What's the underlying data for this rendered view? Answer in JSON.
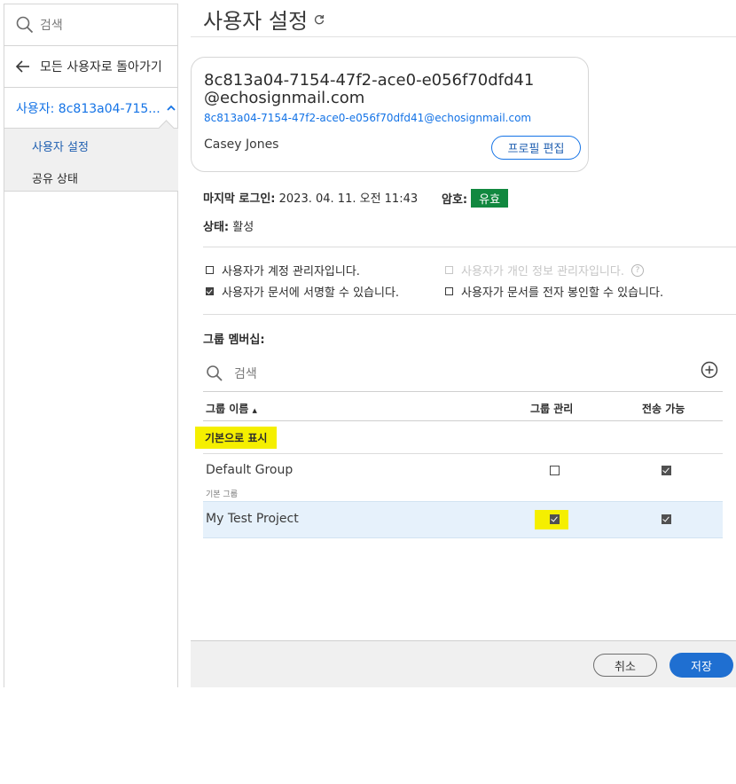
{
  "sidebar": {
    "search_placeholder": "검색",
    "back_label": "모든 사용자로 돌아가기",
    "user_label": "사용자: 8c813a04-715...",
    "items": [
      {
        "label": "사용자 설정",
        "active": true
      },
      {
        "label": "공유 상태",
        "active": false
      }
    ]
  },
  "page": {
    "title": "사용자 설정"
  },
  "profile": {
    "id_line1": "8c813a04-7154-47f2-ace0-e056f70dfd41",
    "id_line2": "@echosignmail.com",
    "email": "8c813a04-7154-47f2-ace0-e056f70dfd41@echosignmail.com",
    "name": "Casey Jones",
    "edit_button": "프로필 편집"
  },
  "status": {
    "last_login_label": "마지막 로그인:",
    "last_login_value": "2023. 04. 11. 오전 11:43",
    "password_label": "암호:",
    "password_value": "유효",
    "state_label": "상태:",
    "state_value": "활성"
  },
  "permissions": [
    {
      "label": "사용자가 계정 관리자입니다.",
      "checked": false,
      "disabled": false
    },
    {
      "label": "사용자가 개인 정보 관리자입니다.",
      "checked": false,
      "disabled": true
    },
    {
      "label": "사용자가 문서에 서명할 수 있습니다.",
      "checked": true,
      "disabled": false
    },
    {
      "label": "사용자가 문서를 전자 봉인할 수 있습니다.",
      "checked": false,
      "disabled": false
    }
  ],
  "groups": {
    "title": "그룹 멤버십:",
    "search_placeholder": "검색",
    "columns": {
      "name": "그룹 이름",
      "admin": "그룹 관리",
      "send": "전송 가능"
    },
    "show_default_label": "기본으로 표시",
    "rows": [
      {
        "name": "Default Group",
        "sub": "기본 그룹",
        "admin": false,
        "send": true
      },
      {
        "name": "My Test Project",
        "sub": "",
        "admin": true,
        "send": true
      }
    ]
  },
  "footer": {
    "cancel": "취소",
    "save": "저장"
  },
  "colors": {
    "accent": "#1473e6",
    "badge": "#11883f",
    "highlight": "#f5ef00"
  }
}
